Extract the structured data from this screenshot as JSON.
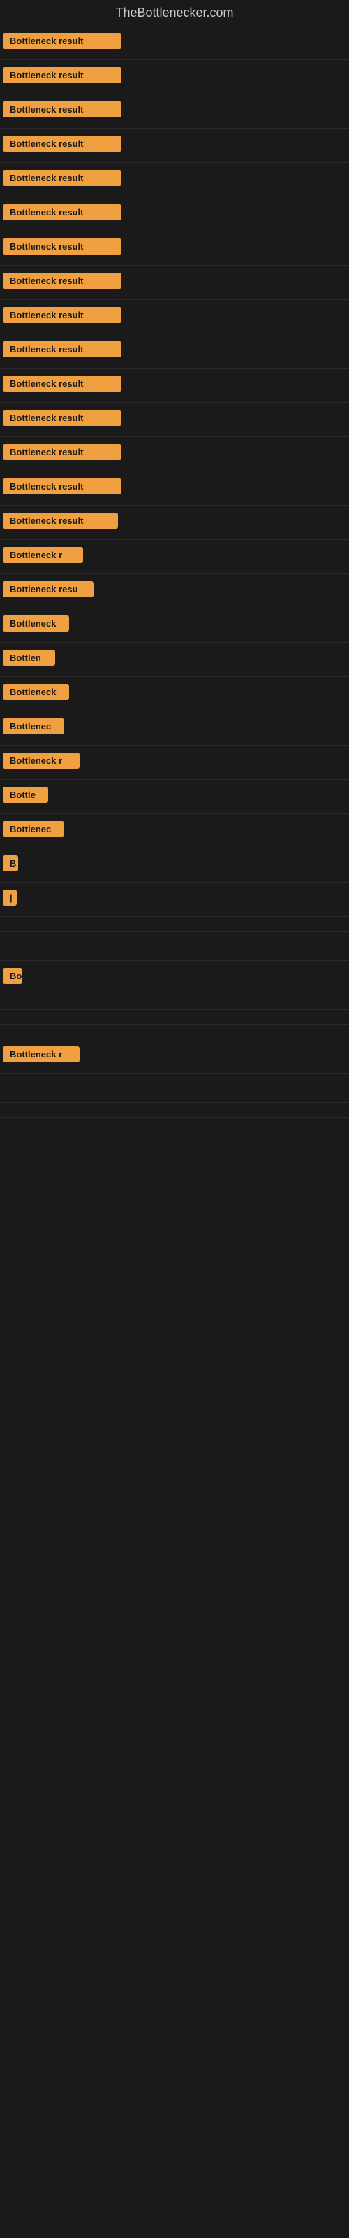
{
  "site": {
    "title": "TheBottlenecker.com"
  },
  "accent_color": "#f0a040",
  "results": [
    {
      "label": "Bottleneck result",
      "width": 170
    },
    {
      "label": "Bottleneck result",
      "width": 170
    },
    {
      "label": "Bottleneck result",
      "width": 170
    },
    {
      "label": "Bottleneck result",
      "width": 170
    },
    {
      "label": "Bottleneck result",
      "width": 170
    },
    {
      "label": "Bottleneck result",
      "width": 170
    },
    {
      "label": "Bottleneck result",
      "width": 170
    },
    {
      "label": "Bottleneck result",
      "width": 170
    },
    {
      "label": "Bottleneck result",
      "width": 170
    },
    {
      "label": "Bottleneck result",
      "width": 170
    },
    {
      "label": "Bottleneck result",
      "width": 170
    },
    {
      "label": "Bottleneck result",
      "width": 170
    },
    {
      "label": "Bottleneck result",
      "width": 170
    },
    {
      "label": "Bottleneck result",
      "width": 170
    },
    {
      "label": "Bottleneck result",
      "width": 165
    },
    {
      "label": "Bottleneck r",
      "width": 115
    },
    {
      "label": "Bottleneck resu",
      "width": 130
    },
    {
      "label": "Bottleneck",
      "width": 95
    },
    {
      "label": "Bottlen",
      "width": 75
    },
    {
      "label": "Bottleneck",
      "width": 95
    },
    {
      "label": "Bottlenec",
      "width": 88
    },
    {
      "label": "Bottleneck r",
      "width": 110
    },
    {
      "label": "Bottle",
      "width": 65
    },
    {
      "label": "Bottlenec",
      "width": 88
    },
    {
      "label": "B",
      "width": 22
    },
    {
      "label": "|",
      "width": 10
    },
    {
      "label": "",
      "width": 0
    },
    {
      "label": "",
      "width": 0
    },
    {
      "label": "",
      "width": 0
    },
    {
      "label": "Bo",
      "width": 28
    },
    {
      "label": "",
      "width": 0
    },
    {
      "label": "",
      "width": 0
    },
    {
      "label": "",
      "width": 0
    },
    {
      "label": "Bottleneck r",
      "width": 110
    },
    {
      "label": "",
      "width": 0
    },
    {
      "label": "",
      "width": 0
    },
    {
      "label": "",
      "width": 0
    }
  ]
}
